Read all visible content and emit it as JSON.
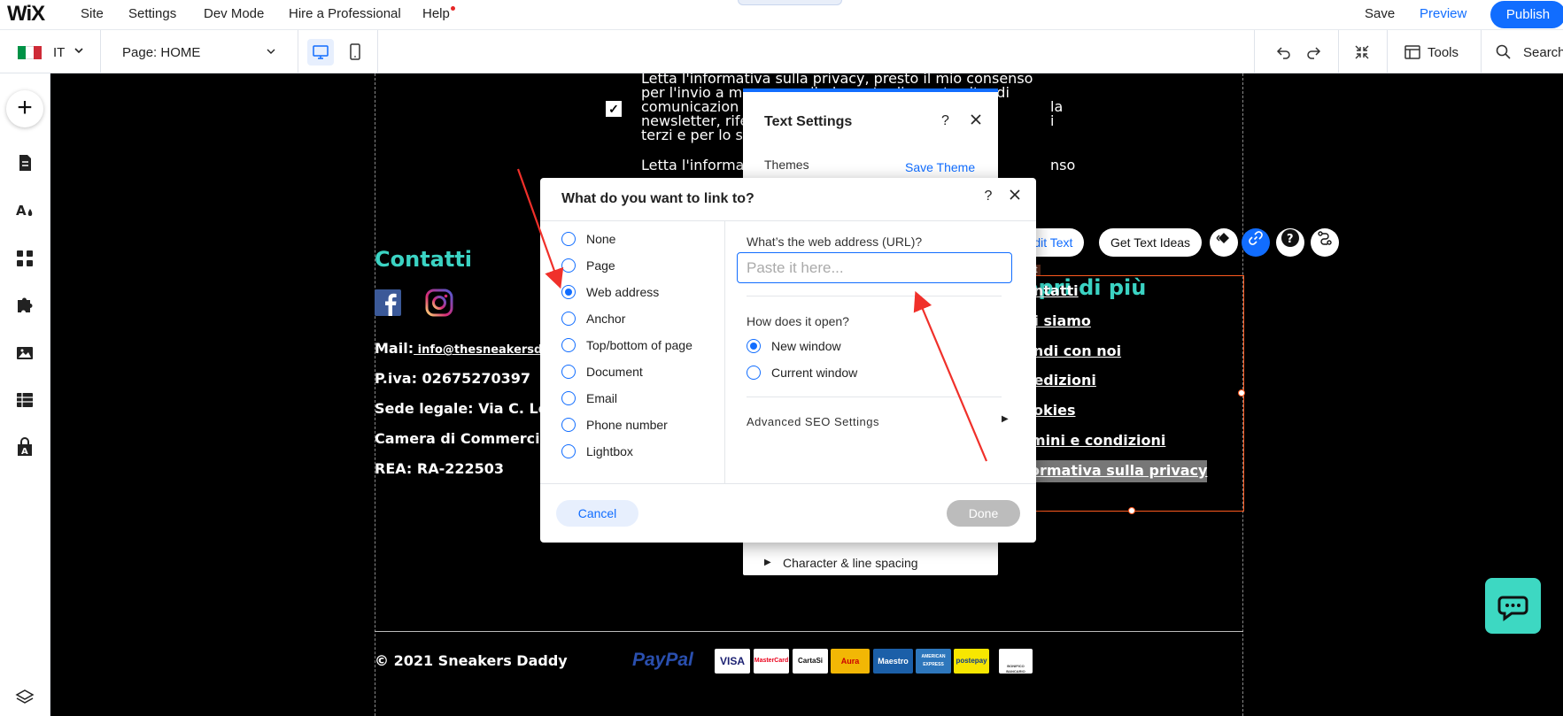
{
  "topbar": {
    "logo": "WiX",
    "menu": [
      "Site",
      "Settings",
      "Dev Mode",
      "Hire a Professional",
      "Help"
    ],
    "save": "Save",
    "preview": "Preview",
    "publish": "Publish"
  },
  "secondbar": {
    "language": "IT",
    "page": "Page: HOME",
    "tools": "Tools",
    "search": "Search"
  },
  "colors": {
    "accent": "#116dff",
    "teal": "#3bd3c3",
    "selection": "#ff5a1f"
  },
  "canvas": {
    "privacy_lines": [
      "Letta l'informativa sulla privacy, presto il mio consenso",
      "per l'invio a mezzo email, da parte di questo sito, di",
      "comunicazion",
      "newsletter, rife",
      "terzi e per lo sv"
    ],
    "privacy_right_fragments": [
      "la",
      "i"
    ],
    "privacy_line2": "Letta l'informa",
    "privacy_line2_end": "nso",
    "contatti_title": "Contatti",
    "info": [
      {
        "label": "Mail:",
        "value": " info@thesneakersdac"
      },
      {
        "label": "P.iva: 02675270397",
        "value": ""
      },
      {
        "label": "Sede legale: Via C. Loll",
        "value": ""
      },
      {
        "label": "Camera di Commercio",
        "value": ""
      },
      {
        "label": "REA: RA-222503",
        "value": ""
      }
    ],
    "scopri_title": "opri di più",
    "scopri_small": "xt",
    "links": [
      "ontatti",
      "hi siamo",
      "endi con noi",
      "pedizioni",
      "ookies",
      "rmini e condizioni ",
      "formativa sulla privacy"
    ],
    "copyright": "© 2021 Sneakers Daddy",
    "paypal": "PayPal",
    "cards": [
      "VISA",
      "MasterCard",
      "CartaSi",
      "Aura",
      "Maestro",
      "AMERICAN EXPRESS",
      "postepay",
      "BONIFICO BANCARIO"
    ]
  },
  "float_toolbar": {
    "edit_text": "Edit Text",
    "get_text_ideas": "Get Text Ideas"
  },
  "text_settings": {
    "title": "Text Settings",
    "themes": "Themes",
    "save_theme": "Save Theme",
    "character_spacing": "Character & line spacing"
  },
  "link_dialog": {
    "title": "What do you want to link to?",
    "options": [
      "None",
      "Page",
      "Web address",
      "Anchor",
      "Top/bottom of page",
      "Document",
      "Email",
      "Phone number",
      "Lightbox"
    ],
    "selected_option": "Web address",
    "url_label": "What’s the web address (URL)?",
    "url_placeholder": "Paste it here...",
    "url_value": "",
    "open_label": "How does it open?",
    "open_options": [
      "New window",
      "Current window"
    ],
    "open_selected": "New window",
    "seo": "Advanced SEO Settings",
    "cancel": "Cancel",
    "done": "Done"
  }
}
